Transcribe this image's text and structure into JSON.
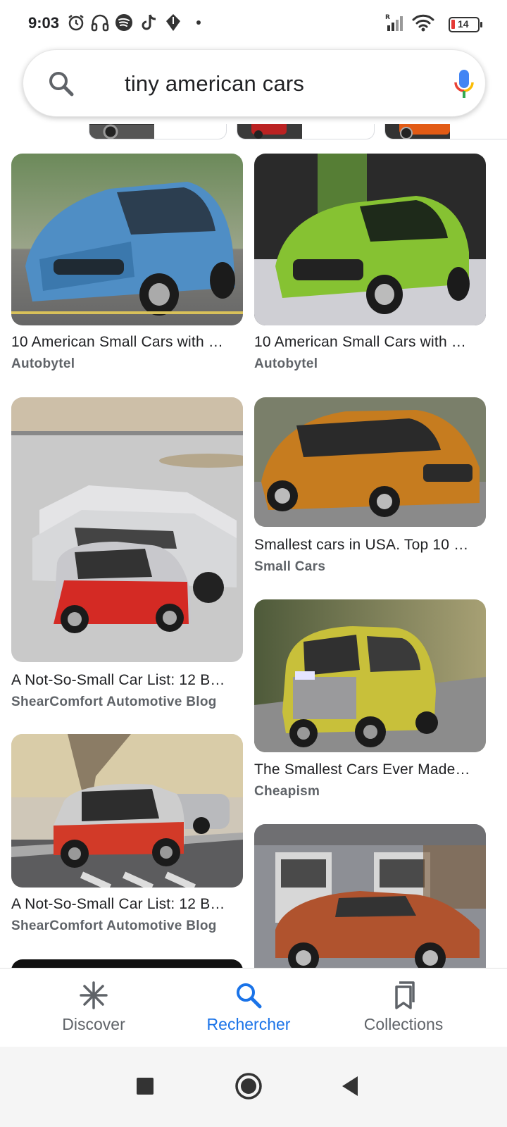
{
  "status_bar": {
    "time": "9:03",
    "battery": "14",
    "icons": [
      "alarm-icon",
      "headphones-icon",
      "spotify-icon",
      "tiktok-icon",
      "app-icon",
      "dot-icon",
      "signal-icon",
      "wifi-icon",
      "battery-icon"
    ]
  },
  "search": {
    "query": "tiny american cars",
    "icons": [
      "search-icon",
      "mic-icon"
    ]
  },
  "results": [
    {
      "title": "10 American Small Cars with …",
      "source": "Autobytel"
    },
    {
      "title": "10 American Small Cars with …",
      "source": "Autobytel"
    },
    {
      "title": "A Not-So-Small Car List: 12 B…",
      "source": "ShearComfort Automotive Blog"
    },
    {
      "title": "Smallest cars in USA. Top 10 …",
      "source": "Small Cars"
    },
    {
      "title": "The Smallest Cars Ever Made…",
      "source": "Cheapism"
    },
    {
      "title": "A Not-So-Small Car List: 12 B…",
      "source": "ShearComfort Automotive Blog"
    }
  ],
  "bottom_nav": {
    "discover": "Discover",
    "search": "Rechercher",
    "collections": "Collections",
    "active": "search"
  },
  "colors": {
    "accent": "#1a73e8",
    "text": "#202124",
    "secondary": "#5f6368"
  }
}
